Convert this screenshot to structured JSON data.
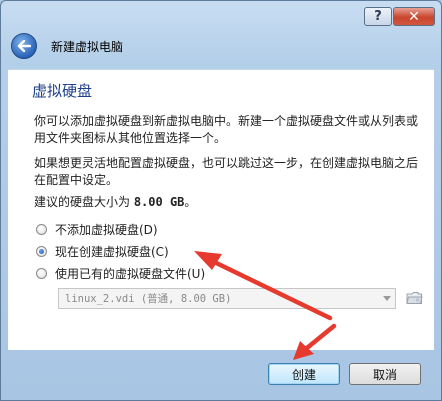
{
  "window": {
    "help_label": "?",
    "close_label": "✕"
  },
  "nav": {
    "title": "新建虚拟电脑"
  },
  "page": {
    "heading": "虚拟硬盘",
    "para1": "你可以添加虚拟硬盘到新虚拟电脑中。新建一个虚拟硬盘文件或从列表或用文件夹图标从其他位置选择一个。",
    "para2": "如果想更灵活地配置虚拟硬盘，也可以跳过这一步，在创建虚拟电脑之后在配置中设定。",
    "size_prefix": "建议的硬盘大小为 ",
    "size_value": "8.00 GB",
    "size_suffix": "。"
  },
  "options": {
    "no_disk": "不添加虚拟硬盘(D)",
    "create_now": "现在创建虚拟硬盘(C)",
    "use_existing": "使用已有的虚拟硬盘文件(U)",
    "selected": "create_now"
  },
  "existing_disk": {
    "value": "linux_2.vdi (普通, 8.00 GB)"
  },
  "buttons": {
    "create": "创建",
    "cancel": "取消"
  },
  "colors": {
    "annotation_arrow": "#e63a2e",
    "heading": "#1e3f8a"
  }
}
